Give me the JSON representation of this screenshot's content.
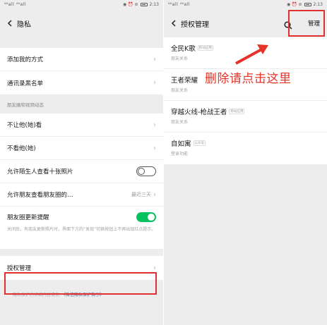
{
  "status": {
    "signal": "⁴⁶all ⁴⁶all",
    "time": "2:13"
  },
  "left": {
    "title": "隐私",
    "rows_top": [
      {
        "label": "添加我的方式"
      },
      {
        "label": "通讯录黑名单"
      }
    ],
    "section_head": "朋友圈和视频动态",
    "rows_moments": [
      {
        "label": "不让他(她)看"
      },
      {
        "label": "不看他(她)"
      }
    ],
    "stranger_photos": {
      "label": "允许陌生人查看十张照片",
      "enabled": false
    },
    "friend_range": {
      "label": "允许朋友查看朋友圈的…",
      "value": "最近三天"
    },
    "moments_update": {
      "label": "朋友圈更新提醒",
      "enabled": true,
      "desc": "关闭后，有朋友更新照片时，界面下方的“发现”切换按钮上不再出现红点提示。"
    },
    "auth": {
      "label": "授权管理"
    },
    "footer": {
      "prefix": "隐私保护的详细内容请见：",
      "link": "《微信隐私保护指引》"
    }
  },
  "right": {
    "title": "授权管理",
    "manage": "管理",
    "apps": [
      {
        "name": "全民K歌",
        "tag": "移动应用",
        "sub": "朋友关系"
      },
      {
        "name": "王者荣耀",
        "tag": "",
        "sub": "朋友关系"
      },
      {
        "name": "穿越火线-枪战王者",
        "tag": "移动应用",
        "sub": "朋友关系"
      },
      {
        "name": "自如寓",
        "tag": "公众号",
        "sub": "登录功能"
      }
    ]
  },
  "annotation": "删除请点击这里",
  "colors": {
    "accent": "#07c160",
    "highlight": "#e03030",
    "annotation": "#e5332a"
  }
}
